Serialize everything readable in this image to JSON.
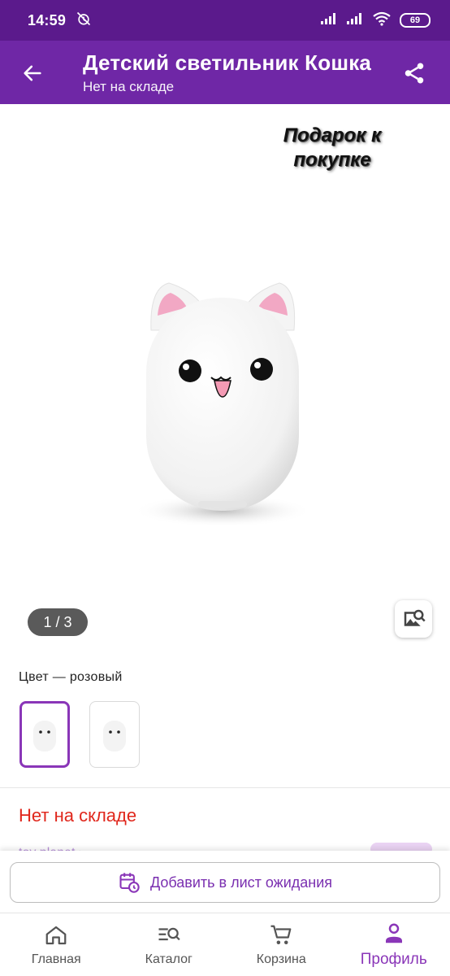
{
  "status_bar": {
    "time": "14:59",
    "battery": "69"
  },
  "app_bar": {
    "title": "Детский светильник Кошка",
    "subtitle": "Нет на складе"
  },
  "gallery": {
    "promo_text": "Подарок к покупке",
    "counter": "1 / 3"
  },
  "color": {
    "label": "Цвет — розовый"
  },
  "availability": {
    "stock_status": "Нет на складе",
    "seller_name_partial": "toy planet ›"
  },
  "actions": {
    "waitlist_label": "Добавить в лист ожидания"
  },
  "bottom_nav": {
    "items": [
      {
        "label": "Главная",
        "icon": "home-icon"
      },
      {
        "label": "Каталог",
        "icon": "catalog-search-icon"
      },
      {
        "label": "Корзина",
        "icon": "cart-icon"
      },
      {
        "label": "Профиль",
        "icon": "profile-icon",
        "active": true
      }
    ]
  },
  "colors": {
    "status_bar": "#5b1a8c",
    "app_bar": "#6f27a6",
    "accent": "#8a36b8",
    "out_of_stock": "#e0261b"
  }
}
